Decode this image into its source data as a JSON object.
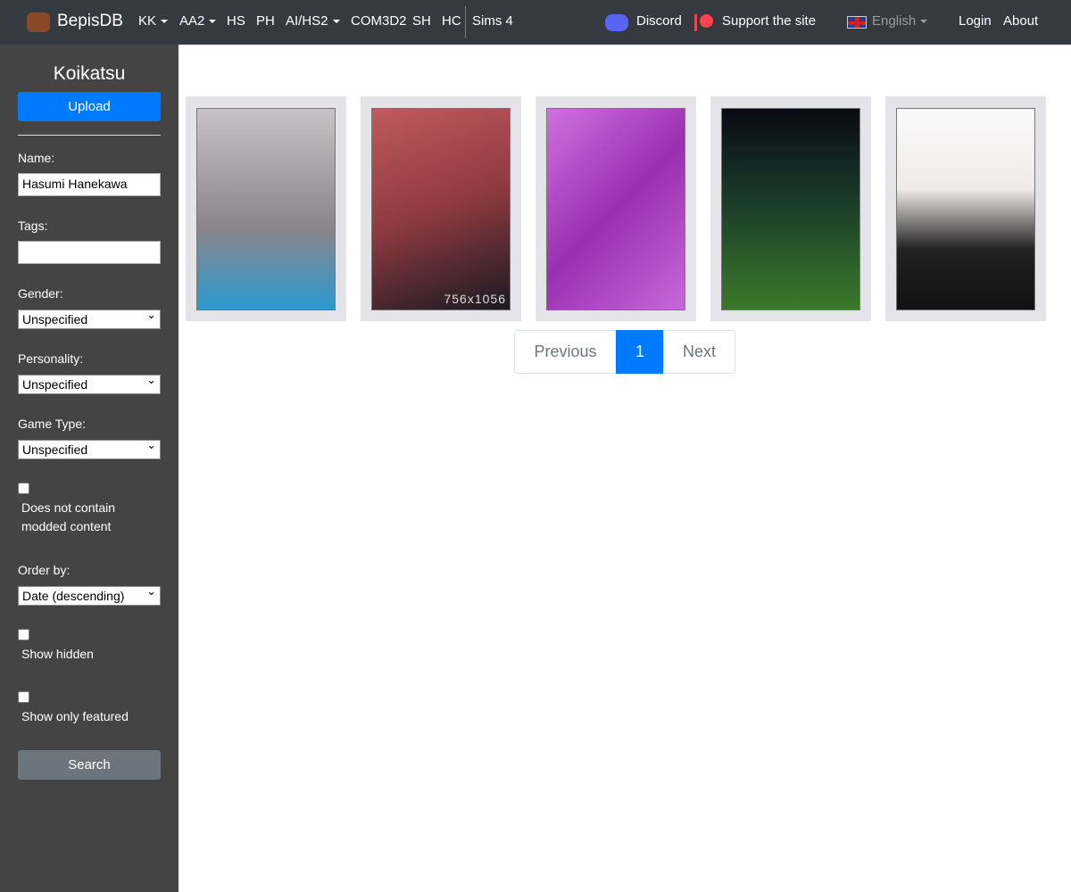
{
  "navbar": {
    "brand": "BepisDB",
    "items": [
      {
        "label": "KK",
        "dropdown": true
      },
      {
        "label": "AA2",
        "dropdown": true
      },
      {
        "label": "HS"
      },
      {
        "label": "PH"
      },
      {
        "label": "AI/HS2",
        "dropdown": true
      },
      {
        "label": "COM3D2"
      },
      {
        "label": "SH"
      },
      {
        "label": "HC"
      },
      {
        "label": "Sims 4"
      }
    ],
    "discord": "Discord",
    "support": "Support the site",
    "language": "English",
    "login": "Login",
    "about": "About"
  },
  "sidebar": {
    "title": "Koikatsu",
    "upload": "Upload",
    "name_label": "Name:",
    "name_value": "Hasumi Hanekawa",
    "tags_label": "Tags:",
    "tags_value": "",
    "gender_label": "Gender:",
    "gender_value": "Unspecified",
    "personality_label": "Personality:",
    "personality_value": "Unspecified",
    "game_type_label": "Game Type:",
    "game_type_value": "Unspecified",
    "no_mods_label": "Does not contain modded content",
    "order_label": "Order by:",
    "order_value": "Date (descending)",
    "show_hidden_label": "Show hidden",
    "featured_label": "Show only featured",
    "search": "Search"
  },
  "cards": [
    {
      "bg": "#b9b3b8"
    },
    {
      "bg": "#a64a4e",
      "overlay": "756x1056"
    },
    {
      "bg": "#b040c0"
    },
    {
      "bg": "#2a4a2a"
    },
    {
      "bg": "#efeaea"
    }
  ],
  "pagination": {
    "previous": "Previous",
    "current": "1",
    "next": "Next",
    "accent": "#007bff"
  }
}
